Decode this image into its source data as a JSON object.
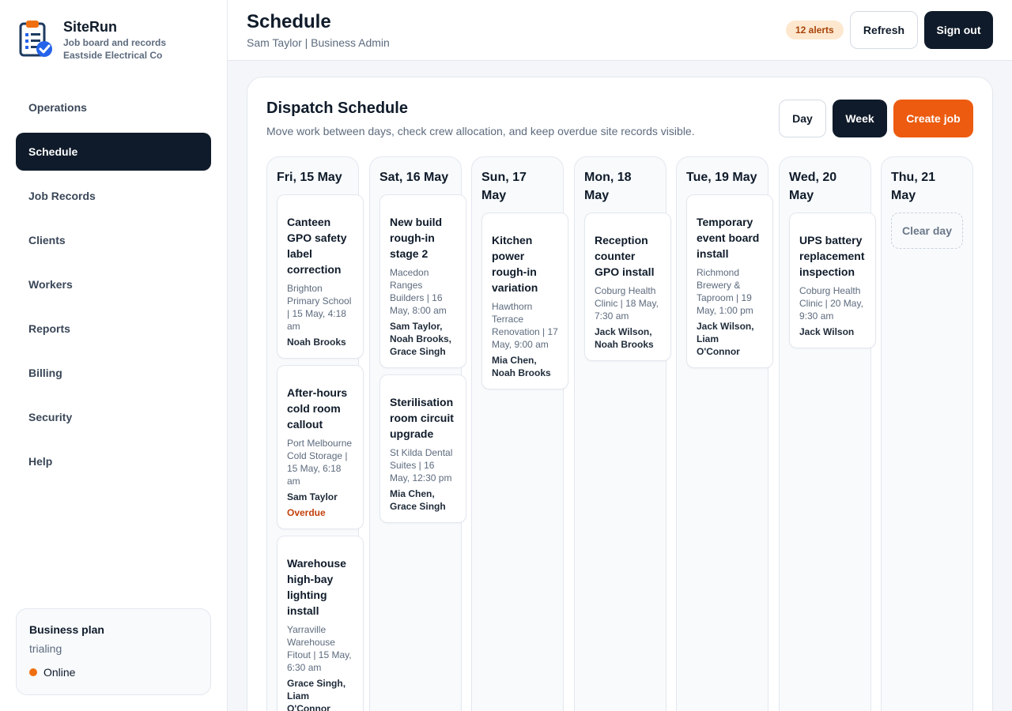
{
  "brand": {
    "name": "SiteRun",
    "tagline": "Job board and records",
    "company": "Eastside Electrical Co",
    "logo_icon": "clipboard-check-logo"
  },
  "nav": [
    {
      "label": "Operations",
      "active": false
    },
    {
      "label": "Schedule",
      "active": true
    },
    {
      "label": "Job Records",
      "active": false
    },
    {
      "label": "Clients",
      "active": false
    },
    {
      "label": "Workers",
      "active": false
    },
    {
      "label": "Reports",
      "active": false
    },
    {
      "label": "Billing",
      "active": false
    },
    {
      "label": "Security",
      "active": false
    },
    {
      "label": "Help",
      "active": false
    }
  ],
  "plan": {
    "title": "Business plan",
    "status": "trialing",
    "online_label": "Online",
    "online_color": "#f0700f"
  },
  "header": {
    "title": "Schedule",
    "user": "Sam Taylor | Business Admin",
    "alerts": "12 alerts",
    "refresh": "Refresh",
    "signout": "Sign out"
  },
  "schedule": {
    "title": "Dispatch Schedule",
    "subtitle": "Move work between days, check crew allocation, and keep overdue site records visible.",
    "view_day": "Day",
    "view_week": "Week",
    "active_view": "Week",
    "create": "Create job",
    "accent_color": "#ec5b0f"
  },
  "columns": [
    {
      "day": "Fri, 15 May",
      "jobs": [
        {
          "title": "Canteen GPO safety label correction",
          "meta": "Brighton Primary School | 15 May, 4:18 am",
          "crew": "Noah Brooks",
          "flag": ""
        },
        {
          "title": "After-hours cold room callout",
          "meta": "Port Melbourne Cold Storage | 15 May, 6:18 am",
          "crew": "Sam Taylor",
          "flag": "Overdue"
        },
        {
          "title": "Warehouse high-bay lighting install",
          "meta": "Yarraville Warehouse Fitout | 15 May, 6:30 am",
          "crew": "Grace Singh, Liam O'Connor",
          "flag": ""
        }
      ]
    },
    {
      "day": "Sat, 16 May",
      "jobs": [
        {
          "title": "New build rough-in stage 2",
          "meta": "Macedon Ranges Builders | 16 May, 8:00 am",
          "crew": "Sam Taylor, Noah Brooks, Grace Singh",
          "flag": ""
        },
        {
          "title": "Sterilisation room circuit upgrade",
          "meta": "St Kilda Dental Suites | 16 May, 12:30 pm",
          "crew": "Mia Chen, Grace Singh",
          "flag": ""
        }
      ]
    },
    {
      "day": "Sun, 17 May",
      "jobs": [
        {
          "title": "Kitchen power rough-in variation",
          "meta": "Hawthorn Terrace Renovation | 17 May, 9:00 am",
          "crew": "Mia Chen, Noah Brooks",
          "flag": ""
        }
      ]
    },
    {
      "day": "Mon, 18 May",
      "jobs": [
        {
          "title": "Reception counter GPO install",
          "meta": "Coburg Health Clinic | 18 May, 7:30 am",
          "crew": "Jack Wilson, Noah Brooks",
          "flag": ""
        }
      ]
    },
    {
      "day": "Tue, 19 May",
      "jobs": [
        {
          "title": "Temporary event board install",
          "meta": "Richmond Brewery & Taproom | 19 May, 1:00 pm",
          "crew": "Jack Wilson, Liam O'Connor",
          "flag": ""
        }
      ]
    },
    {
      "day": "Wed, 20 May",
      "jobs": [
        {
          "title": "UPS battery replacement inspection",
          "meta": "Coburg Health Clinic | 20 May, 9:30 am",
          "crew": "Jack Wilson",
          "flag": ""
        }
      ]
    },
    {
      "day": "Thu, 21 May",
      "jobs": [],
      "empty_action": "Clear day"
    }
  ]
}
